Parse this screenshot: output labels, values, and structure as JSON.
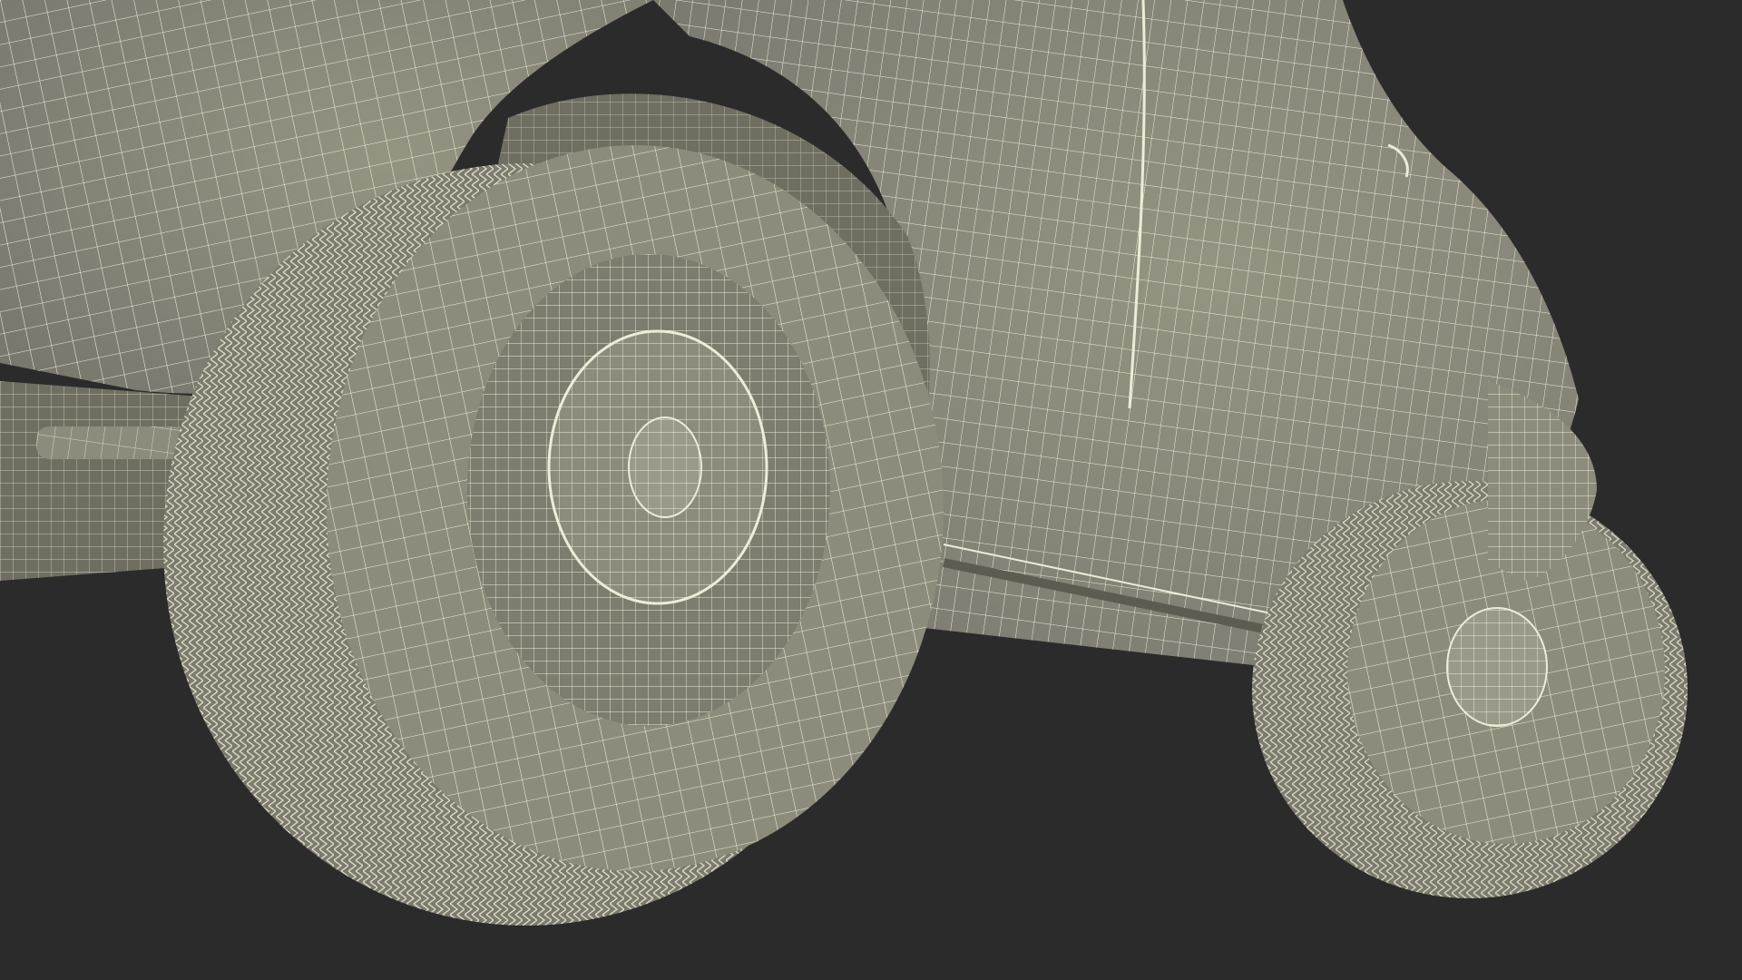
{
  "scene": {
    "subject": "wireframe-render",
    "colors": {
      "background": "#2b2b2b",
      "surface": "#8d8c7c",
      "surface_shadow": "#6f6e61",
      "surface_dark": "#5d5c51",
      "wire": "#eeecd8"
    }
  }
}
